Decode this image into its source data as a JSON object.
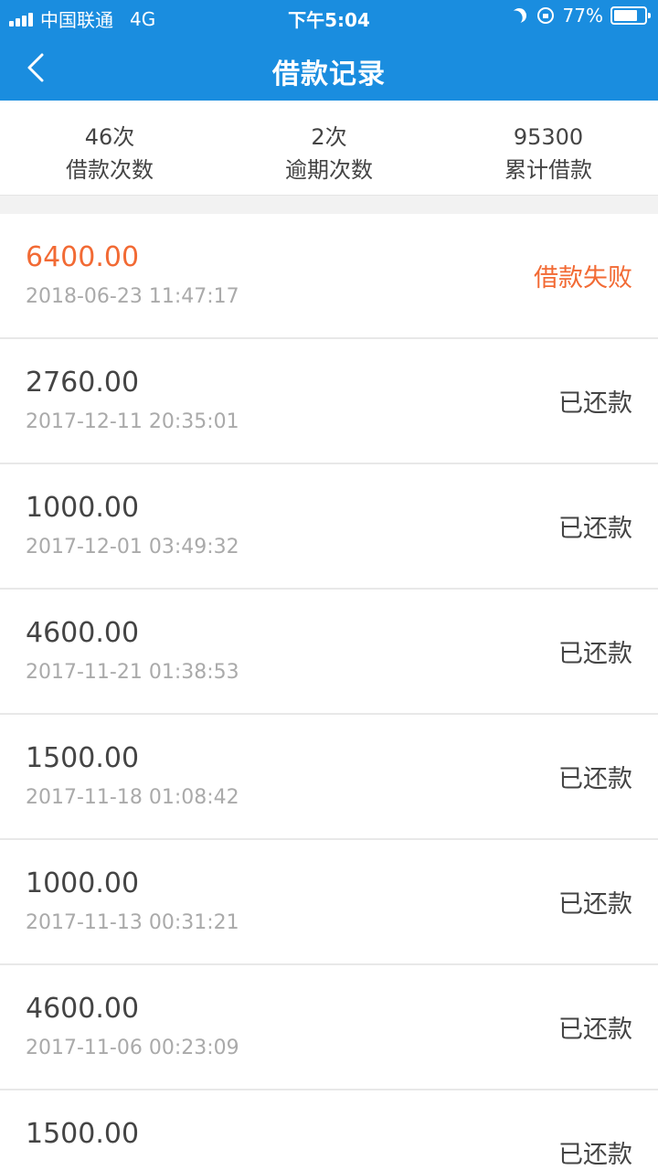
{
  "status_bar": {
    "carrier": "中国联通",
    "network": "4G",
    "time": "下午5:04",
    "battery": "77%",
    "battery_level": 0.77
  },
  "header": {
    "title": "借款记录",
    "back_icon": "chevron-left-icon"
  },
  "summary": [
    {
      "value": "46次",
      "label": "借款次数"
    },
    {
      "value": "2次",
      "label": "逾期次数"
    },
    {
      "value": "95300",
      "label": "累计借款"
    }
  ],
  "records": [
    {
      "amount": "6400.00",
      "date": "2018-06-23 11:47:17",
      "status": "借款失败",
      "failed": true
    },
    {
      "amount": "2760.00",
      "date": "2017-12-11 20:35:01",
      "status": "已还款",
      "failed": false
    },
    {
      "amount": "1000.00",
      "date": "2017-12-01 03:49:32",
      "status": "已还款",
      "failed": false
    },
    {
      "amount": "4600.00",
      "date": "2017-11-21 01:38:53",
      "status": "已还款",
      "failed": false
    },
    {
      "amount": "1500.00",
      "date": "2017-11-18 01:08:42",
      "status": "已还款",
      "failed": false
    },
    {
      "amount": "1000.00",
      "date": "2017-11-13 00:31:21",
      "status": "已还款",
      "failed": false
    },
    {
      "amount": "4600.00",
      "date": "2017-11-06 00:23:09",
      "status": "已还款",
      "failed": false
    },
    {
      "amount": "1500.00",
      "date": "",
      "status": "已还款",
      "failed": false
    }
  ],
  "colors": {
    "header_bg": "#1a8ddf",
    "fail": "#f26a34"
  }
}
